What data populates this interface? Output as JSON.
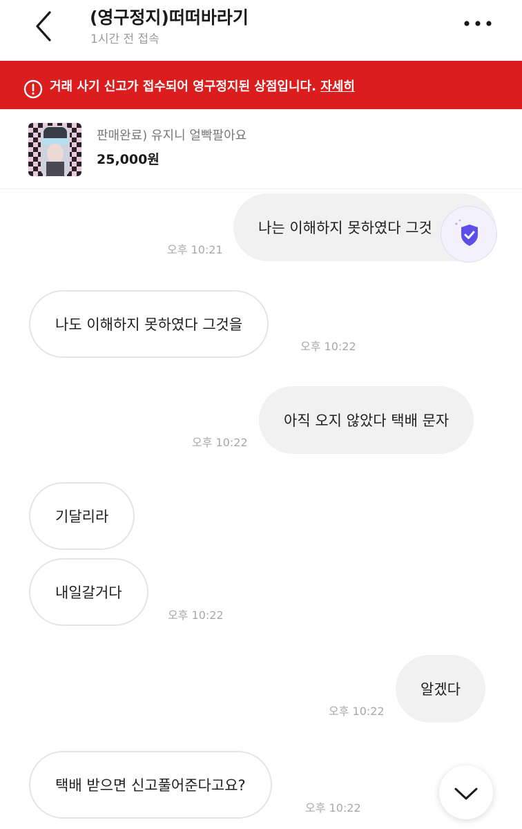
{
  "header": {
    "title": "(영구정지)떠떠바라기",
    "status": "1시간 전 접속"
  },
  "banner": {
    "message": "거래 사기 신고가 접수되어 영구정지된 상점입니다.",
    "link": "자세히",
    "color": "#db1d1d"
  },
  "product": {
    "name": "판매완료) 유지니 얼빡팔아요",
    "price": "25,000원"
  },
  "messages": [
    {
      "side": "out",
      "text": "나는 이해하지 못하였다 그것",
      "time": "오후 10:21"
    },
    {
      "side": "in",
      "text": "나도 이해하지 못하였다 그것을",
      "time": "오후 10:22"
    },
    {
      "side": "out",
      "text": "아직 오지 않았다 택배 문자",
      "time": "오후 10:22"
    },
    {
      "side": "in",
      "text": "기달리라",
      "time": ""
    },
    {
      "side": "in",
      "text": "내일갈거다",
      "time": "오후 10:22"
    },
    {
      "side": "out",
      "text": "알겠다",
      "time": "오후 10:22"
    },
    {
      "side": "in",
      "text": "택배 받으면 신고풀어준다고요?",
      "time": "오후 10:22"
    }
  ],
  "icons": {
    "back": "chevron-left-icon",
    "more": "more-dots-icon",
    "alert": "alert-circle-icon",
    "shield": "shield-check-icon",
    "scroll_down": "chevron-down-icon"
  }
}
